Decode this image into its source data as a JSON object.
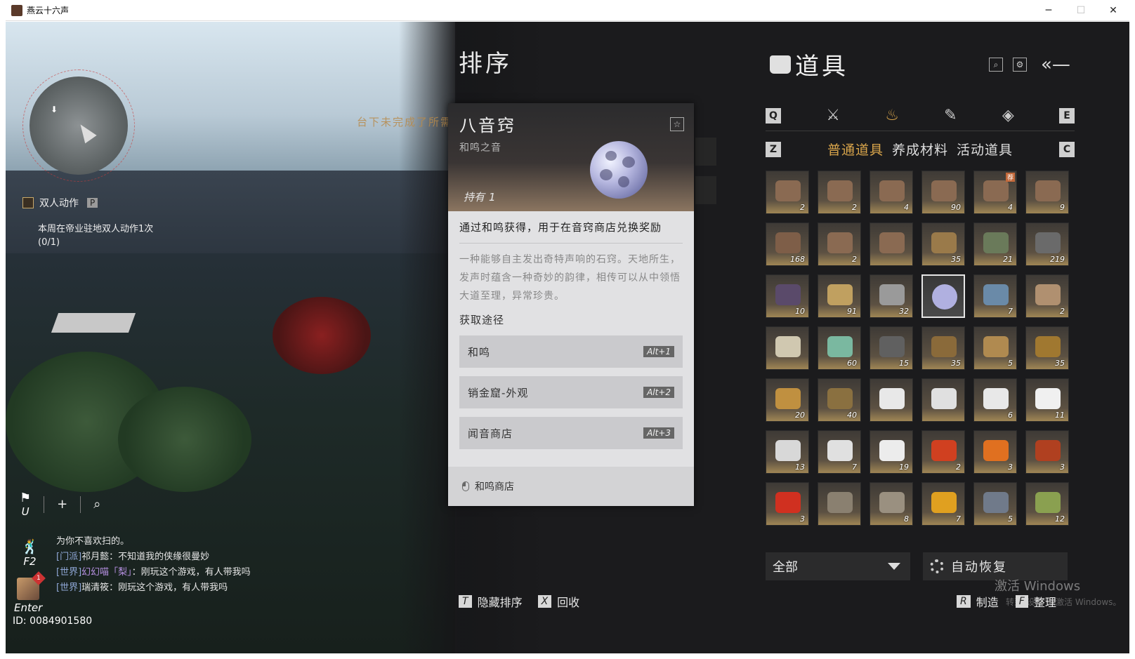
{
  "window": {
    "title": "燕云十六声",
    "minimize": "─",
    "maximize": "☐",
    "close": "✕"
  },
  "hud": {
    "quest": {
      "title": "双人动作",
      "key": "P",
      "line1": "本周在帝业驻地双人动作1次",
      "line2": "(0/1)"
    },
    "banner": "台下未完成了所需",
    "tools": {
      "flag_key": "U",
      "add": "+",
      "search": "⌕",
      "f2_key": "F2",
      "enter_key": "Enter",
      "badge": "1"
    },
    "user_id": "ID: 0084901580",
    "chat": [
      {
        "tag": "",
        "name": "",
        "text": "为你不喜欢扫的。"
      },
      {
        "tag": "[门派]",
        "name": "祁月懿",
        "text": "：不知道我的侠缘很曼妙"
      },
      {
        "tag": "[世界]",
        "name": "幻幻喵「梨」",
        "text": "：刚玩这个游戏，有人带我吗"
      },
      {
        "tag": "[世界]",
        "name": "瑞清筱",
        "text": "：刚玩这个游戏，有人带我吗"
      }
    ]
  },
  "sort": {
    "title": "排序"
  },
  "detail": {
    "name": "八音窍",
    "subtitle": "和鸣之音",
    "hold_label": "持有",
    "hold_count": "1",
    "desc1": "通过和鸣获得，用于在音窍商店兑换奖励",
    "desc2": "一种能够自主发出奇特声响的石窍。天地所生，发声时蕴含一种奇妙的韵律，相传可以从中领悟大道至理，异常珍贵。",
    "sources_title": "获取途径",
    "sources": [
      {
        "label": "和鸣",
        "key": "Alt+1"
      },
      {
        "label": "销金窟-外观",
        "key": "Alt+2"
      },
      {
        "label": "闻音商店",
        "key": "Alt+3"
      }
    ],
    "footer": "和鸣商店"
  },
  "bottom_actions": [
    {
      "key": "T",
      "label": "隐藏排序"
    },
    {
      "key": "X",
      "label": "回收"
    }
  ],
  "inventory": {
    "title": "道具",
    "keys": {
      "q": "Q",
      "e": "E",
      "z": "Z",
      "c": "C"
    },
    "categories": [
      "weapon-icon",
      "pouch-icon",
      "scroll-icon",
      "gem-icon"
    ],
    "sub_tabs": [
      "普通道具",
      "养成材料",
      "活动道具"
    ],
    "items": [
      {
        "count": "2",
        "color": "#8a6a52"
      },
      {
        "count": "2",
        "color": "#8a6a52"
      },
      {
        "count": "4",
        "color": "#8a6a52"
      },
      {
        "count": "90",
        "color": "#8a6a52"
      },
      {
        "count": "4",
        "color": "#8a6a52",
        "tag": "荐"
      },
      {
        "count": "9",
        "color": "#8a6a52"
      },
      {
        "count": "168",
        "color": "#7e5e48"
      },
      {
        "count": "2",
        "color": "#8a6a52"
      },
      {
        "count": "",
        "color": "#8a6a52"
      },
      {
        "count": "35",
        "color": "#9a7a4a"
      },
      {
        "count": "21",
        "color": "#6a7a5a"
      },
      {
        "count": "219",
        "color": "#6a6a6a"
      },
      {
        "count": "10",
        "color": "#5a4a6a"
      },
      {
        "count": "91",
        "color": "#c0a060"
      },
      {
        "count": "32",
        "color": "#9a9a9a"
      },
      {
        "count": "",
        "color": "#b0b0e0",
        "selected": true
      },
      {
        "count": "7",
        "color": "#6a8aa8"
      },
      {
        "count": "2",
        "color": "#b09070"
      },
      {
        "count": "",
        "color": "#d0c8b0"
      },
      {
        "count": "60",
        "color": "#7ab8a0"
      },
      {
        "count": "15",
        "color": "#606060"
      },
      {
        "count": "35",
        "color": "#8a6a3a"
      },
      {
        "count": "5",
        "color": "#b08a50"
      },
      {
        "count": "35",
        "color": "#a07830"
      },
      {
        "count": "20",
        "color": "#c09040"
      },
      {
        "count": "40",
        "color": "#8a7040"
      },
      {
        "count": "",
        "color": "#e8e8e8"
      },
      {
        "count": "",
        "color": "#e0e0e0"
      },
      {
        "count": "6",
        "color": "#e8e8e8"
      },
      {
        "count": "11",
        "color": "#f0f0f0"
      },
      {
        "count": "13",
        "color": "#d8d8d8"
      },
      {
        "count": "7",
        "color": "#e0e0e0"
      },
      {
        "count": "19",
        "color": "#ececec"
      },
      {
        "count": "2",
        "color": "#d04020"
      },
      {
        "count": "3",
        "color": "#e07020"
      },
      {
        "count": "3",
        "color": "#b04020"
      },
      {
        "count": "3",
        "color": "#d03020"
      },
      {
        "count": "",
        "color": "#8a8070"
      },
      {
        "count": "8",
        "color": "#9a9080"
      },
      {
        "count": "7",
        "color": "#e0a020"
      },
      {
        "count": "5",
        "color": "#707a8a"
      },
      {
        "count": "12",
        "color": "#8aa050"
      }
    ],
    "filter_label": "全部",
    "auto_label": "自动恢复",
    "actions": [
      {
        "key": "R",
        "label": "制造"
      },
      {
        "key": "F",
        "label": "整理"
      }
    ]
  },
  "watermark": {
    "line1": "激活 Windows",
    "line2": "转到\"设置\"以激活 Windows。"
  }
}
